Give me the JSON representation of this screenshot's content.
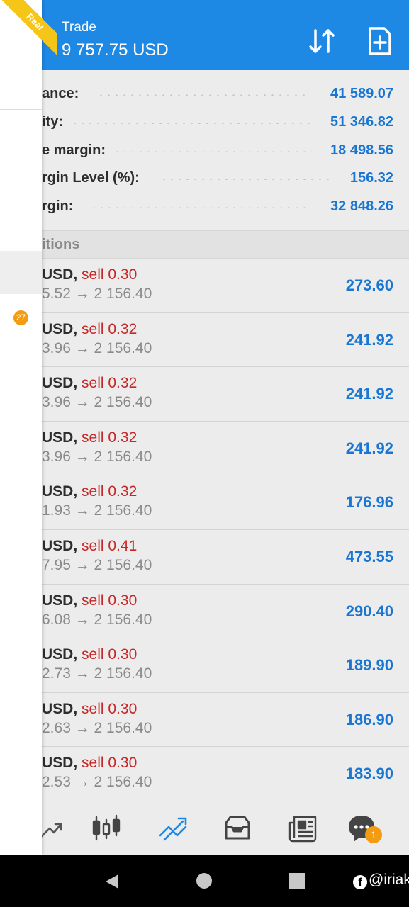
{
  "header": {
    "title": "Trade",
    "balance": "9 757.75 USD"
  },
  "summary": [
    {
      "label": "ance:",
      "value": "41 589.07"
    },
    {
      "label": "ity:",
      "value": "51 346.82"
    },
    {
      "label": "e margin:",
      "value": "18 498.56"
    },
    {
      "label": "rgin Level (%):",
      "value": "156.32"
    },
    {
      "label": "rgin:",
      "value": "32 848.26"
    }
  ],
  "section_title": "itions",
  "positions": [
    {
      "symbol": "USD,",
      "side": "sell 0.30",
      "prices": "5.52 → 2 156.40",
      "profit": "273.60"
    },
    {
      "symbol": "USD,",
      "side": "sell 0.32",
      "prices": "3.96 → 2 156.40",
      "profit": "241.92"
    },
    {
      "symbol": "USD,",
      "side": "sell 0.32",
      "prices": "3.96 → 2 156.40",
      "profit": "241.92"
    },
    {
      "symbol": "USD,",
      "side": "sell 0.32",
      "prices": "3.96 → 2 156.40",
      "profit": "241.92"
    },
    {
      "symbol": "USD,",
      "side": "sell 0.32",
      "prices": "1.93 → 2 156.40",
      "profit": "176.96"
    },
    {
      "symbol": "USD,",
      "side": "sell 0.41",
      "prices": "7.95 → 2 156.40",
      "profit": "473.55"
    },
    {
      "symbol": "USD,",
      "side": "sell 0.30",
      "prices": "6.08 → 2 156.40",
      "profit": "290.40"
    },
    {
      "symbol": "USD,",
      "side": "sell 0.30",
      "prices": "2.73 → 2 156.40",
      "profit": "189.90"
    },
    {
      "symbol": "USD,",
      "side": "sell 0.30",
      "prices": "2.63 → 2 156.40",
      "profit": "186.90"
    },
    {
      "symbol": "USD,",
      "side": "sell 0.30",
      "prices": "2.53 → 2 156.40",
      "profit": "183.90"
    }
  ],
  "nav": {
    "items": [
      "chart-icon",
      "candlesticks-icon",
      "trade-icon",
      "inbox-icon",
      "news-icon",
      "chat-icon"
    ],
    "chat_badge": "1"
  },
  "drawer": {
    "ribbon": "Real",
    "count_badge": "27"
  },
  "watermark": "@iriak",
  "colors": {
    "header": "#1e88e5",
    "profit": "#1976d2",
    "sell": "#c62828",
    "badge": "#f39c12",
    "ribbon": "#f5c518"
  }
}
